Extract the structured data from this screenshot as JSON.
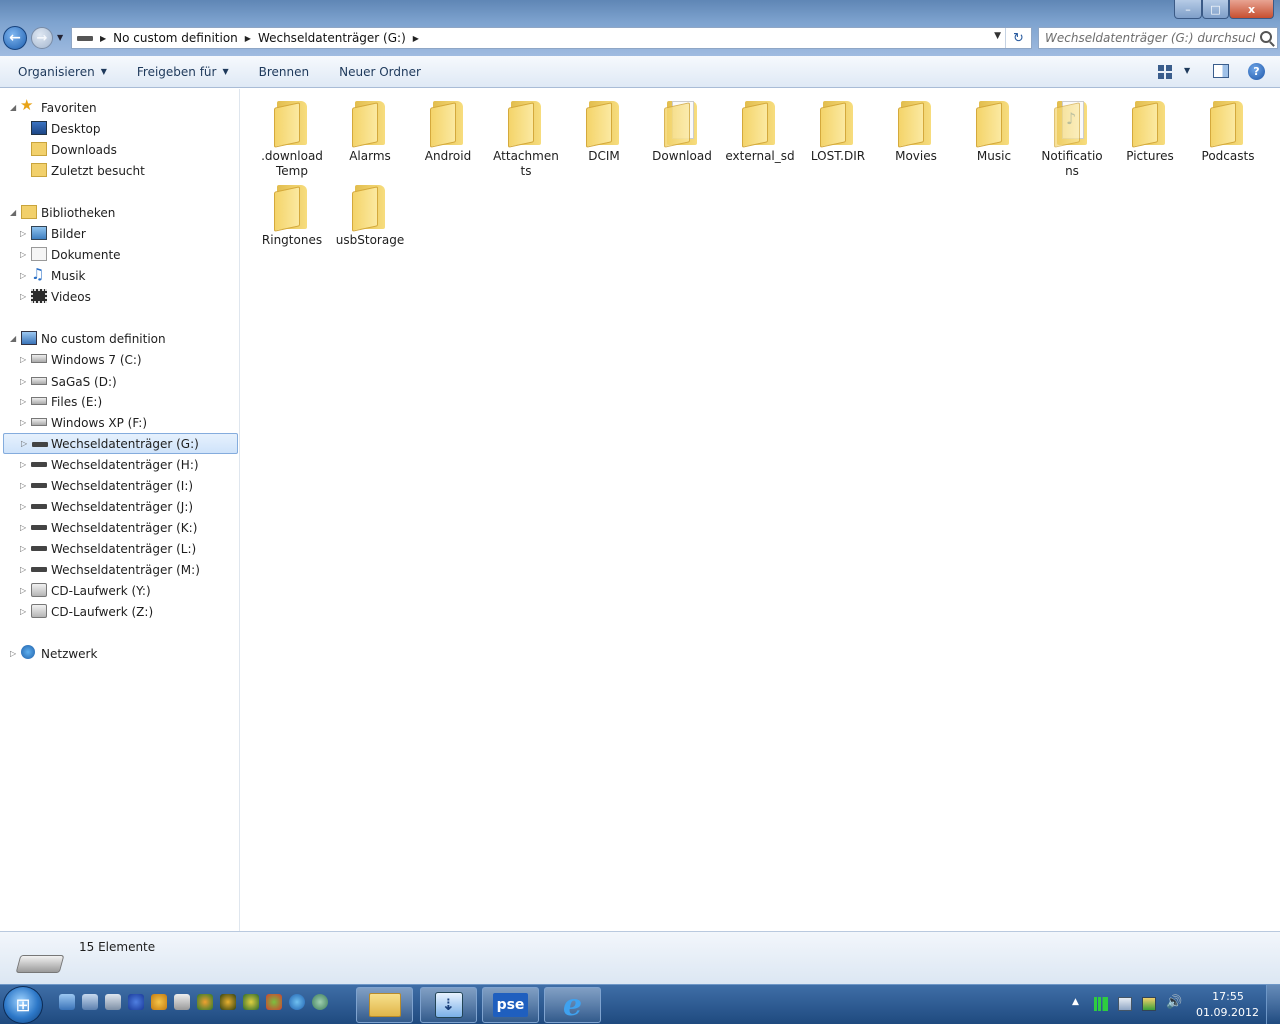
{
  "window": {
    "min_label": "–",
    "max_label": "□",
    "close_label": "x"
  },
  "address": {
    "segments": [
      "No custom definition",
      "Wechseldatenträger (G:)"
    ]
  },
  "search": {
    "placeholder": "Wechseldatenträger (G:) durchsuchen"
  },
  "commandbar": {
    "organize": "Organisieren",
    "share": "Freigeben für",
    "burn": "Brennen",
    "new_folder": "Neuer Ordner",
    "help": "?"
  },
  "nav": {
    "favorites": {
      "label": "Favoriten",
      "items": [
        "Desktop",
        "Downloads",
        "Zuletzt besucht"
      ]
    },
    "libraries": {
      "label": "Bibliotheken",
      "items": [
        "Bilder",
        "Dokumente",
        "Musik",
        "Videos"
      ]
    },
    "computer": {
      "label": "No custom definition",
      "items": [
        "Windows 7 (C:)",
        "SaGaS (D:)",
        "Files (E:)",
        "Windows XP (F:)",
        "Wechseldatenträger (G:)",
        "Wechseldatenträger (H:)",
        "Wechseldatenträger (I:)",
        "Wechseldatenträger (J:)",
        "Wechseldatenträger (K:)",
        "Wechseldatenträger (L:)",
        "Wechseldatenträger (M:)",
        "CD-Laufwerk (Y:)",
        "CD-Laufwerk (Z:)"
      ],
      "selected": "Wechseldatenträger (G:)"
    },
    "network": {
      "label": "Netzwerk"
    }
  },
  "folders": [
    {
      "line1": ".download",
      "line2": "Temp",
      "icon": "folder-icon"
    },
    {
      "line1": "Alarms",
      "line2": "",
      "icon": "folder-icon"
    },
    {
      "line1": "Android",
      "line2": "",
      "icon": "folder-icon"
    },
    {
      "line1": "Attachmen",
      "line2": "ts",
      "icon": "folder-icon"
    },
    {
      "line1": "DCIM",
      "line2": "",
      "icon": "folder-icon"
    },
    {
      "line1": "Download",
      "line2": "",
      "icon": "folder-document-icon"
    },
    {
      "line1": "external_sd",
      "line2": "",
      "icon": "folder-icon"
    },
    {
      "line1": "LOST.DIR",
      "line2": "",
      "icon": "folder-icon"
    },
    {
      "line1": "Movies",
      "line2": "",
      "icon": "folder-icon"
    },
    {
      "line1": "Music",
      "line2": "",
      "icon": "folder-icon"
    },
    {
      "line1": "Notificatio",
      "line2": "ns",
      "icon": "folder-music-icon"
    },
    {
      "line1": "Pictures",
      "line2": "",
      "icon": "folder-icon"
    },
    {
      "line1": "Podcasts",
      "line2": "",
      "icon": "folder-icon"
    },
    {
      "line1": "Ringtones",
      "line2": "",
      "icon": "folder-icon"
    },
    {
      "line1": "usbStorage",
      "line2": "",
      "icon": "folder-icon"
    }
  ],
  "status": {
    "count": "15 Elemente"
  },
  "taskbar": {
    "start_glyph": "⊞",
    "pse_label": "pse",
    "ie_label": "e",
    "clock_time": "17:55",
    "clock_date": "01.09.2012"
  },
  "colors": {
    "selection": "#cfe3fa",
    "titlebar": "#7ea3cf",
    "taskbar": "#1f4a7f",
    "folder": "#f4d46a"
  }
}
